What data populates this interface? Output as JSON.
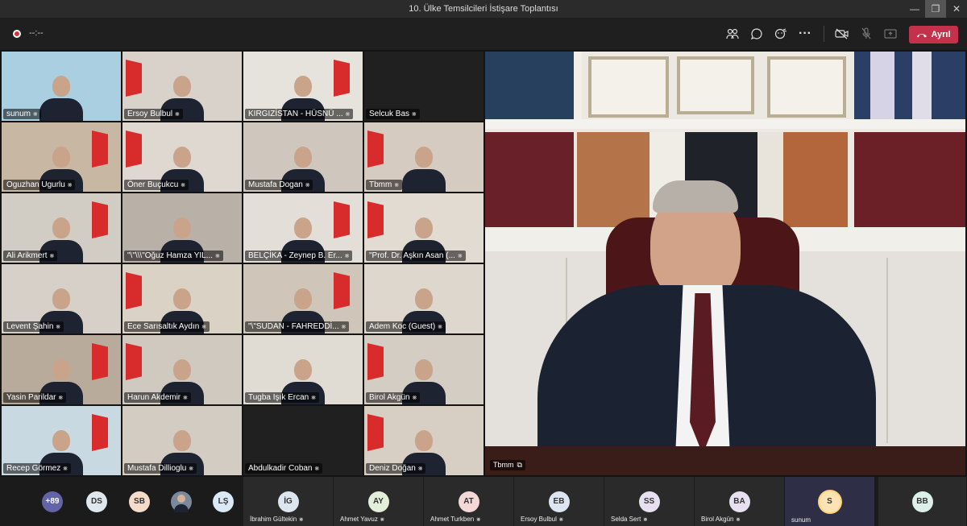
{
  "window": {
    "title": "10. Ülke Temsilcileri İstişare Toplantısı",
    "controls": [
      "—",
      "❐",
      "✕"
    ]
  },
  "toolbar": {
    "timer": "--:--",
    "leave_label": "Ayrıl",
    "icons": [
      "people-icon",
      "chat-icon",
      "reactions-icon",
      "more-icon",
      "camera-off-icon",
      "mic-off-icon",
      "share-icon"
    ]
  },
  "grid": [
    {
      "name": "sunum",
      "bg": "#a9cfe0"
    },
    {
      "name": "Ersoy Bulbul",
      "bg": "#d8d2cb"
    },
    {
      "name": "KIRGIZİSTAN - HÜSNÜ ...",
      "bg": "#e6e2dc"
    },
    {
      "name": "Selcuk Bas",
      "bg": "#202020"
    },
    {
      "name": "Oguzhan Ugurlu",
      "bg": "#c7b7a3"
    },
    {
      "name": "Öner Buçukcu",
      "bg": "#ded8d0"
    },
    {
      "name": "Mustafa Dogan",
      "bg": "#cfc7bd"
    },
    {
      "name": "Tbmm",
      "bg": "#d5cbc0"
    },
    {
      "name": "Ali Arikmert",
      "bg": "#d1ccc4"
    },
    {
      "name": "\"\\\"\\\\\\\"Oğuz Hamza YIL...",
      "bg": "#b9b0a8"
    },
    {
      "name": "BELÇİKA - Zeynep B. Er...",
      "bg": "#e3ded8"
    },
    {
      "name": "\"Prof. Dr. Aşkın Asan (...",
      "bg": "#e2dbd2"
    },
    {
      "name": "Levent Şahin",
      "bg": "#d6d0c8"
    },
    {
      "name": "Ece Sarısaltık Aydın",
      "bg": "#d9d2c5"
    },
    {
      "name": "\"\\\"SUDAN - FAHREDDİ...",
      "bg": "#cfc5b8"
    },
    {
      "name": "Adem Koc (Guest)",
      "bg": "#ddd7ce"
    },
    {
      "name": "Yasin Parildar",
      "bg": "#b8ab9c"
    },
    {
      "name": "Harun Akdemir",
      "bg": "#cfc9c0"
    },
    {
      "name": "Tugba Işık Ercan",
      "bg": "#e0dbd3"
    },
    {
      "name": "Birol Akgün",
      "bg": "#d4cdc3"
    },
    {
      "name": "Recep Görmez",
      "bg": "#c9d9e2"
    },
    {
      "name": "Mustafa Dillioglu",
      "bg": "#d3ccc2"
    },
    {
      "name": "Abdulkadir Coban",
      "bg": "#202020"
    },
    {
      "name": "Deniz Doğan",
      "bg": "#d7cfc4"
    }
  ],
  "main_video": {
    "name": "Tbmm"
  },
  "participants": [
    {
      "initials": "+89",
      "name": "",
      "color": "#6264a7"
    },
    {
      "initials": "DS",
      "name": "",
      "color": "#dfe7ef"
    },
    {
      "initials": "SB",
      "name": "",
      "color": "#f4dcc8"
    },
    {
      "initials": "",
      "name": "",
      "color": "#7a8a9a"
    },
    {
      "initials": "LŞ",
      "name": "",
      "color": "#dbe8f5"
    },
    {
      "initials": "İG",
      "name": "İbrahim Gültekin",
      "color": "#dde5ee"
    },
    {
      "initials": "AY",
      "name": "Ahmet Yavuz",
      "color": "#e4efd9"
    },
    {
      "initials": "AT",
      "name": "Ahmet Turkben",
      "color": "#f4d8d8"
    },
    {
      "initials": "EB",
      "name": "Ersoy Bulbul",
      "color": "#dde5f3"
    },
    {
      "initials": "SS",
      "name": "Selda Sert",
      "color": "#e6e0f0"
    },
    {
      "initials": "BA",
      "name": "Birol Akgün",
      "color": "#e6e0f0"
    },
    {
      "initials": "S",
      "name": "sunum",
      "color": "#fbe3b4"
    },
    {
      "initials": "BB",
      "name": "",
      "color": "#dcefe8"
    }
  ]
}
